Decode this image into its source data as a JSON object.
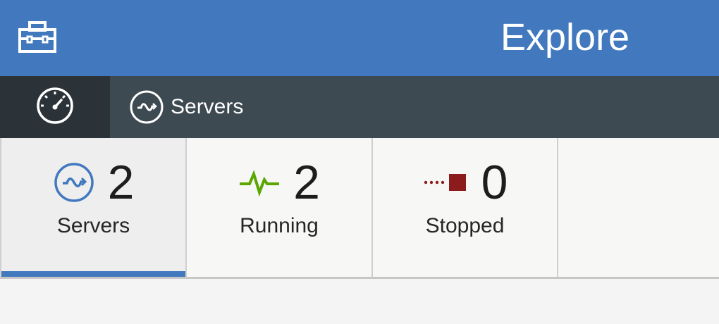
{
  "banner": {
    "title": "Explore",
    "toolbox_icon": "toolbox-icon",
    "background": "#4178be"
  },
  "subnav": {
    "dashboard_icon": "speedometer-icon",
    "crumb": {
      "label": "Servers",
      "icon": "server-sync-icon"
    },
    "background": "#3d4a52"
  },
  "tabs": [
    {
      "label": "Servers",
      "count": "2",
      "icon": "server-sync-icon",
      "icon_color": "#4178be",
      "selected": true
    },
    {
      "label": "Running",
      "count": "2",
      "icon": "pulse-icon",
      "icon_color": "#5aa700",
      "selected": false
    },
    {
      "label": "Stopped",
      "count": "0",
      "icon": "stopped-icon",
      "icon_color": "#8c1b1b",
      "selected": false
    }
  ],
  "colors": {
    "accent": "#4178be",
    "running": "#5aa700",
    "stopped": "#8c1b1b"
  }
}
